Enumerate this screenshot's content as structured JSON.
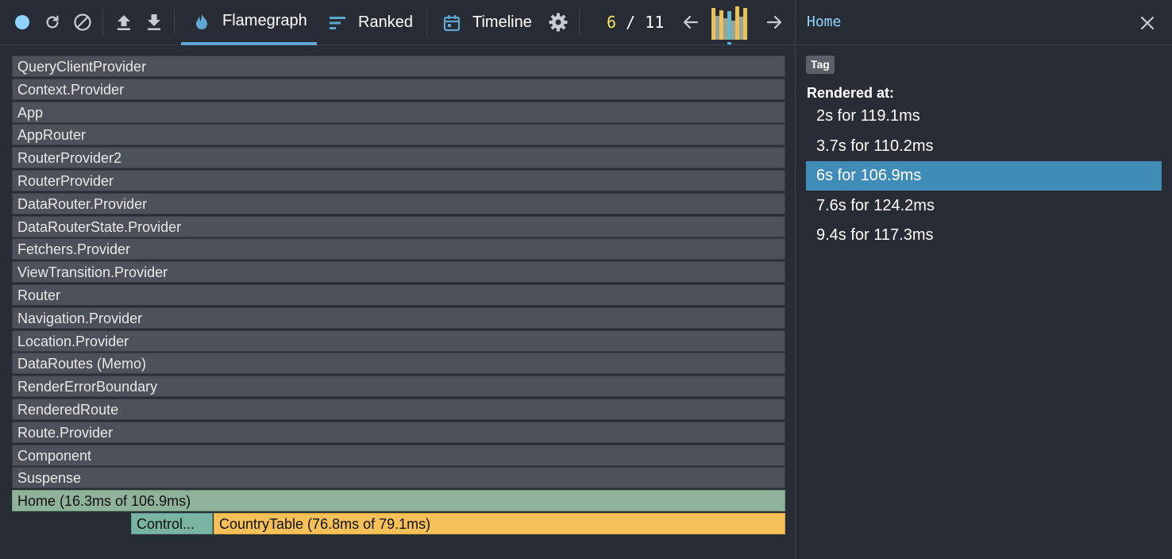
{
  "toolbar": {
    "record_icon": "record-dot-icon",
    "reload_icon": "reload-icon",
    "clear_icon": "clear-icon",
    "load_icon": "upload-icon",
    "save_icon": "download-icon",
    "tabs": [
      {
        "label": "Flamegraph",
        "icon": "flame-icon",
        "active": true
      },
      {
        "label": "Ranked",
        "icon": "ranked-icon",
        "active": false
      },
      {
        "label": "Timeline",
        "icon": "calendar-icon",
        "active": false
      }
    ],
    "settings_icon": "gear-icon",
    "commit_current": "6",
    "commit_separator": " / ",
    "commit_total": "11",
    "prev_icon": "arrow-left-icon",
    "next_icon": "arrow-right-icon",
    "commit_durations_ms": [
      119.1,
      90.0,
      110.2,
      80.0,
      106.9,
      70.0,
      124.2,
      85.0,
      117.3
    ],
    "commit_selected_index": 4,
    "colors": {
      "accent": "#5fa7d0",
      "counter_current": "#f2e45f",
      "bar_yellow": "#e9c15b",
      "bar_gray": "#9aa39a",
      "bar_teal": "#67b8c4"
    }
  },
  "flamegraph": {
    "rows": [
      "QueryClientProvider",
      "Context.Provider",
      "App",
      "AppRouter",
      "RouterProvider2",
      "RouterProvider",
      "DataRouter.Provider",
      "DataRouterState.Provider",
      "Fetchers.Provider",
      "ViewTransition.Provider",
      "Router",
      "Navigation.Provider",
      "Location.Provider",
      "DataRoutes (Memo)",
      "RenderErrorBoundary",
      "RenderedRoute",
      "Route.Provider",
      "Component",
      "Suspense"
    ],
    "home": "Home (16.3ms of 106.9ms)",
    "children": [
      {
        "label": "Control...",
        "color": "#78b3a4"
      },
      {
        "label": "CountryTable (76.8ms of 79.1ms)",
        "color": "#f4c057"
      }
    ]
  },
  "panel": {
    "title": "Home",
    "close_icon": "close-icon",
    "tag": "Tag",
    "rendered_at_label": "Rendered at:",
    "renders": [
      {
        "label": "2s for 119.1ms",
        "selected": false
      },
      {
        "label": "3.7s for 110.2ms",
        "selected": false
      },
      {
        "label": "6s for 106.9ms",
        "selected": true
      },
      {
        "label": "7.6s for 124.2ms",
        "selected": false
      },
      {
        "label": "9.4s for 117.3ms",
        "selected": false
      }
    ],
    "selected_color": "#3f8cb9"
  }
}
